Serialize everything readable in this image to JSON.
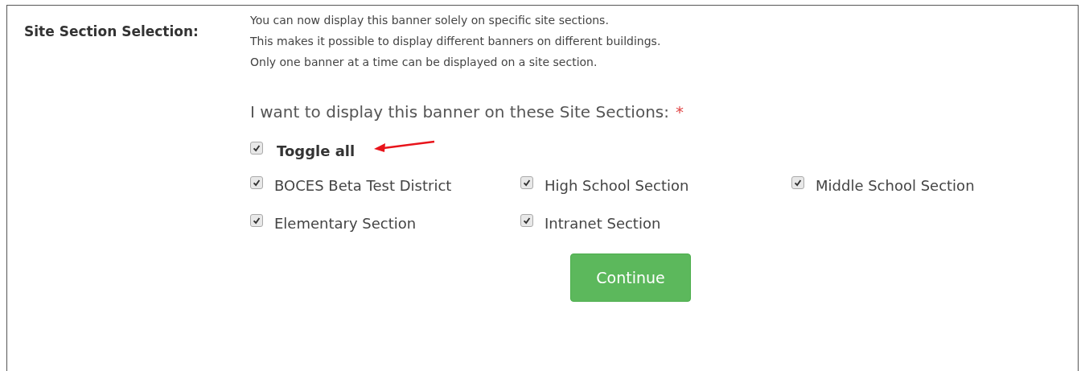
{
  "label": "Site Section Selection:",
  "notes": [
    "You can now display this banner solely on specific site sections.",
    "This makes it possible to display different banners on different buildings.",
    "Only one banner at a time can be displayed on a site section."
  ],
  "question": {
    "text": "I want to display this banner on these Site Sections:",
    "required_mark": "*"
  },
  "toggle_all": {
    "label": "Toggle all",
    "checked": true
  },
  "sections": [
    {
      "label": "BOCES Beta Test District",
      "checked": true
    },
    {
      "label": "High School Section",
      "checked": true
    },
    {
      "label": "Middle School Section",
      "checked": true
    },
    {
      "label": "Elementary Section",
      "checked": true
    },
    {
      "label": "Intranet Section",
      "checked": true
    }
  ],
  "buttons": [
    "Continue"
  ]
}
